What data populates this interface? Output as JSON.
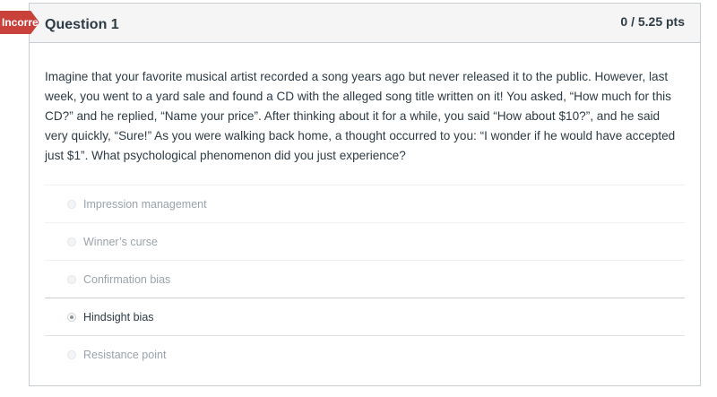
{
  "flag": {
    "label": "Incorrect",
    "color": "#c8413b"
  },
  "question": {
    "title": "Question 1",
    "points": "0 / 5.25 pts",
    "text": "Imagine that your favorite musical artist recorded a song years ago but never released it to the public. However, last week, you went to a yard sale and found a CD with the alleged song title written on it! You asked, “How much for this CD?” and he replied, “Name your price”. After thinking about it for a while, you said “How about $10?”, and he said very quickly, “Sure!” As you were walking back home, a thought occurred to you: “I wonder if he would have accepted just $1”. What psychological phenomenon did you just experience?",
    "answers": [
      {
        "label": "Impression management",
        "selected": false
      },
      {
        "label": "Winner’s curse",
        "selected": false
      },
      {
        "label": "Confirmation bias",
        "selected": false
      },
      {
        "label": "Hindsight bias",
        "selected": true
      },
      {
        "label": "Resistance point",
        "selected": false
      }
    ]
  }
}
